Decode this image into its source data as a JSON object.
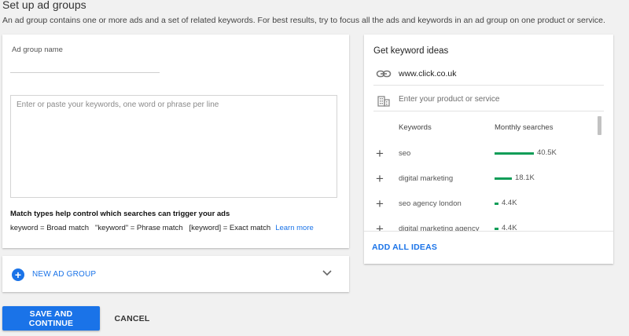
{
  "page": {
    "title": "Set up ad groups",
    "description": "An ad group contains one or more ads and a set of related keywords. For best results, try to focus all the ads and keywords in an ad group on one product or service."
  },
  "ad_group": {
    "name_label": "Ad group name",
    "name_value": "",
    "keywords_placeholder": "Enter or paste your keywords, one word or phrase per line",
    "match_heading": "Match types help control which searches can trigger your ads",
    "match_types": "keyword = Broad match   \"keyword\" = Phrase match   [keyword] = Exact match",
    "learn_more": "Learn more"
  },
  "new_ad_group": {
    "label": "NEW AD GROUP",
    "icons": {
      "add": "plus-circle-icon",
      "expand": "chevron-down-icon"
    }
  },
  "keyword_ideas": {
    "title": "Get keyword ideas",
    "url": "www.click.co.uk",
    "product_placeholder": "Enter your product or service",
    "columns": {
      "keywords": "Keywords",
      "monthly_searches": "Monthly searches"
    },
    "ideas": [
      {
        "keyword": "seo",
        "monthly_searches": "40.5K",
        "searches_value": 40500
      },
      {
        "keyword": "digital marketing",
        "monthly_searches": "18.1K",
        "searches_value": 18100
      },
      {
        "keyword": "seo agency london",
        "monthly_searches": "4.4K",
        "searches_value": 4400
      },
      {
        "keyword": "digital marketing agency",
        "monthly_searches": "4.4K",
        "searches_value": 4400
      }
    ],
    "add_all_label": "ADD ALL IDEAS",
    "icons": {
      "url": "link-icon",
      "product": "building-icon",
      "add_idea": "plus-icon"
    }
  },
  "actions": {
    "save_label": "SAVE AND CONTINUE",
    "cancel_label": "CANCEL"
  },
  "colors": {
    "accent": "#1a73e8",
    "bar": "#0f9d58",
    "background": "#f1f1f1"
  }
}
